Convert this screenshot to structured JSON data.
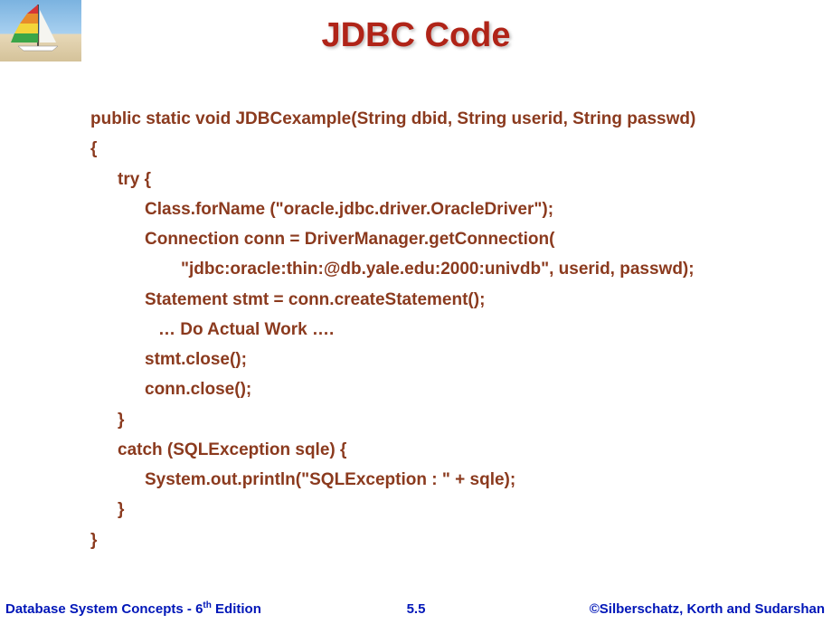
{
  "title": "JDBC Code",
  "code": {
    "line1": "public static void JDBCexample(String dbid, String userid, String passwd)",
    "line2": "{",
    "line3": "try {",
    "line4": "Class.forName (\"oracle.jdbc.driver.OracleDriver\");",
    "line5": "Connection conn = DriverManager.getConnection(",
    "line6": "\"jdbc:oracle:thin:@db.yale.edu:2000:univdb\", userid, passwd);",
    "line7": "Statement stmt = conn.createStatement();",
    "line8": "… Do Actual Work ….",
    "line9": "stmt.close();",
    "line10": "conn.close();",
    "line11": "}",
    "line12": "catch (SQLException sqle) {",
    "line13": "System.out.println(\"SQLException : \" + sqle);",
    "line14": "}",
    "line15": "}"
  },
  "footer": {
    "left_prefix": "Database System Concepts - 6",
    "left_sup": "th",
    "left_suffix": " Edition",
    "center": "5.5",
    "right": "©Silberschatz, Korth and Sudarshan"
  }
}
